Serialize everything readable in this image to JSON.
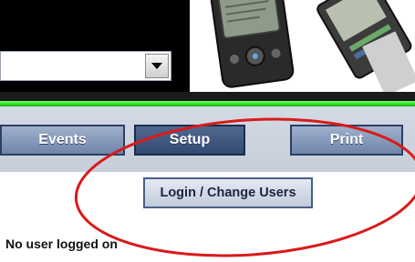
{
  "header": {
    "dropdown": {
      "value": "",
      "icon": "chevron-down-icon"
    },
    "device_image": {
      "icon": "handheld-device-icon"
    }
  },
  "nav": {
    "tabs": [
      {
        "label": "Events",
        "active": false
      },
      {
        "label": "Setup",
        "active": true
      },
      {
        "label": "Print",
        "active": false
      }
    ]
  },
  "submenu": {
    "login_label": "Login / Change Users"
  },
  "status": {
    "text": "No user logged on"
  },
  "colors": {
    "green_bar": "#2ee52a",
    "nav_button": "#6f84a8",
    "nav_button_active": "#3a5078",
    "highlight_circle": "#d81b1b"
  }
}
